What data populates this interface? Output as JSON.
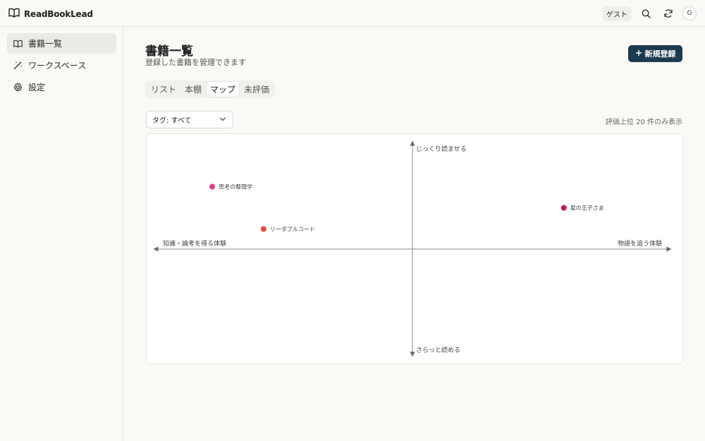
{
  "app": {
    "name": "ReadBookLead"
  },
  "header": {
    "guest_label": "ゲスト",
    "avatar_initial": "G"
  },
  "sidebar": {
    "items": [
      {
        "label": "書籍一覧",
        "icon": "book-icon",
        "active": true
      },
      {
        "label": "ワークスペース",
        "icon": "magic-wand-icon",
        "active": false
      },
      {
        "label": "設定",
        "icon": "gear-icon",
        "active": false
      }
    ]
  },
  "main": {
    "title": "書籍一覧",
    "subtitle": "登録した書籍を管理できます",
    "new_button_label": "新規登録",
    "tabs": [
      {
        "label": "リスト",
        "active": false
      },
      {
        "label": "本棚",
        "active": false
      },
      {
        "label": "マップ",
        "active": true
      },
      {
        "label": "未評価",
        "active": false
      }
    ],
    "tag_filter": {
      "value": "タグ: すべて"
    },
    "top_note": "評価上位 20 件のみ表示"
  },
  "chart_data": {
    "type": "scatter",
    "axes": {
      "y_top_label": "じっくり読ませる",
      "y_bottom_label": "さらっと読める",
      "x_left_label": "知識・論考を得る体験",
      "x_right_label": "物語を追う体験",
      "xlim": [
        -1,
        1
      ],
      "ylim": [
        -1,
        1
      ]
    },
    "points": [
      {
        "label": "思考の整理学",
        "x": -0.78,
        "y": 0.59,
        "color": "#d63f8c"
      },
      {
        "label": "リーダブルコード",
        "x": -0.58,
        "y": 0.19,
        "color": "#e14b3f"
      },
      {
        "label": "星の王子さま",
        "x": 0.59,
        "y": 0.39,
        "color": "#c4185e"
      }
    ]
  }
}
